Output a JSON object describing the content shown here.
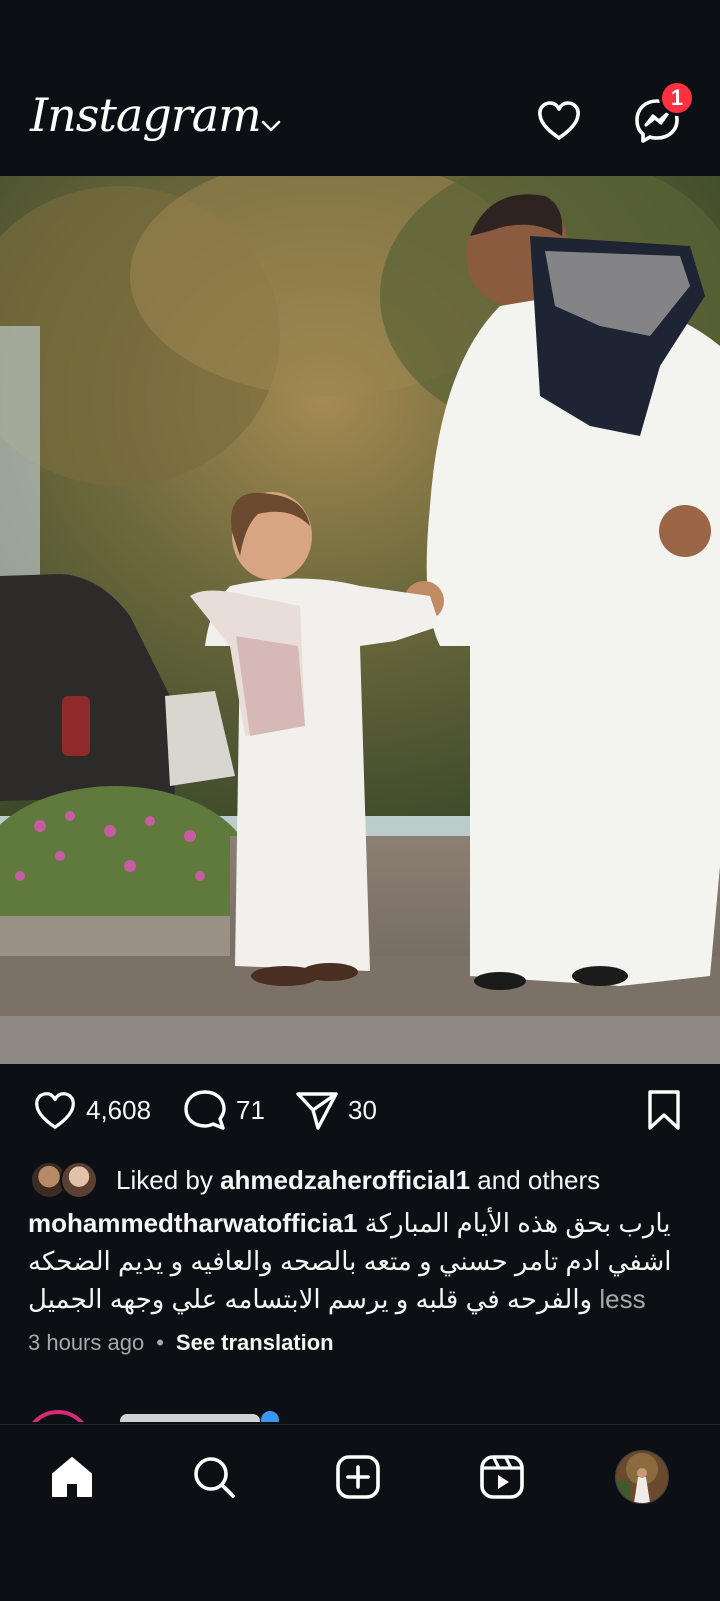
{
  "app": {
    "title": "Instagram",
    "logo_text": "Instagram"
  },
  "header": {
    "notifications_icon": "heart-icon",
    "messenger_icon": "messenger-icon",
    "messenger_badge": "1"
  },
  "post": {
    "likes": "4,608",
    "comments": "71",
    "shares": "30",
    "liked_by_prefix": "Liked by",
    "liked_by_user": "ahmedzaherofficial1",
    "liked_by_suffix": "and others",
    "author": "mohammedtharwatofficia1",
    "caption_line1": "يارب بحق هذه الأيام المباركة",
    "caption_line2": "اشفي ادم تامر حسني و متعه بالصحه والعافيه و يديم الضحكه",
    "caption_line3": "والفرحه في قلبه و يرسم الابتسامه علي وجهه الجميل",
    "less_label": "less",
    "time": "3 hours ago",
    "see_translation": "See translation"
  },
  "bottom_nav": {
    "items": [
      "home-icon",
      "search-icon",
      "create-icon",
      "reels-icon",
      "profile-avatar"
    ]
  },
  "colors": {
    "background": "#0c1014",
    "text": "#f5f5f5",
    "muted": "#a8a8a8",
    "badge": "#ff3040"
  }
}
